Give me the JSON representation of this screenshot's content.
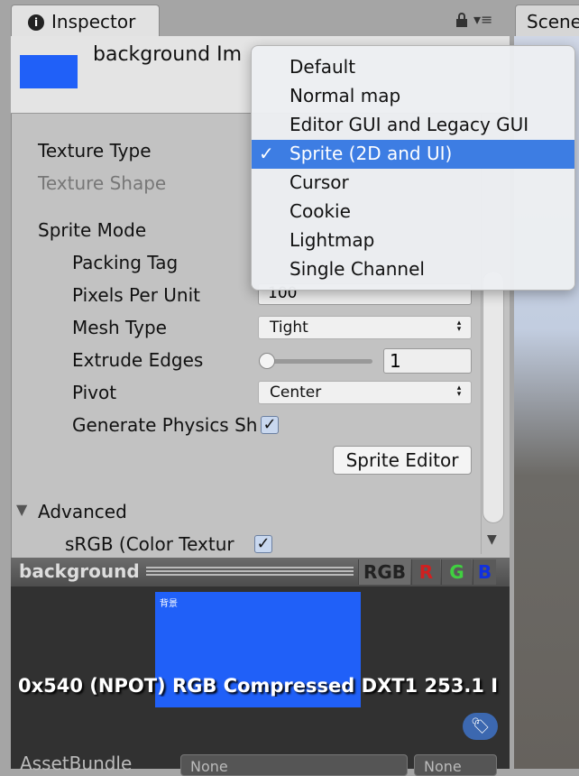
{
  "tabs": {
    "inspector": "Inspector",
    "scene": "Scene"
  },
  "header": {
    "title": "background Im"
  },
  "fields": {
    "texture_type": "Texture Type",
    "texture_shape": "Texture Shape",
    "sprite_mode": "Sprite Mode",
    "packing_tag": "Packing Tag",
    "pixels_per_unit": "Pixels Per Unit",
    "pixels_per_unit_value": "100",
    "mesh_type": "Mesh Type",
    "mesh_type_value": "Tight",
    "extrude_edges": "Extrude Edges",
    "extrude_edges_value": "1",
    "extrude_slider_value": 0,
    "pivot": "Pivot",
    "pivot_value": "Center",
    "generate_physics": "Generate Physics Sh",
    "generate_physics_checked": true,
    "sprite_editor": "Sprite Editor",
    "advanced": "Advanced",
    "srgb": "sRGB (Color Textur",
    "srgb_checked": true
  },
  "dropdown": {
    "items": [
      "Default",
      "Normal map",
      "Editor GUI and Legacy GUI",
      "Sprite (2D and UI)",
      "Cursor",
      "Cookie",
      "Lightmap",
      "Single Channel"
    ],
    "selected": "Sprite (2D and UI)",
    "check": "✓"
  },
  "preview": {
    "name": "background",
    "channels": [
      "RGB",
      "R",
      "G",
      "B"
    ],
    "image_text": "背景",
    "info": "0x540 (NPOT)  RGB Compressed DXT1   253.1 I",
    "image_color": "#2060f8"
  },
  "asset_bundle": {
    "label": "AssetBundle",
    "name": "None",
    "variant": "None"
  }
}
